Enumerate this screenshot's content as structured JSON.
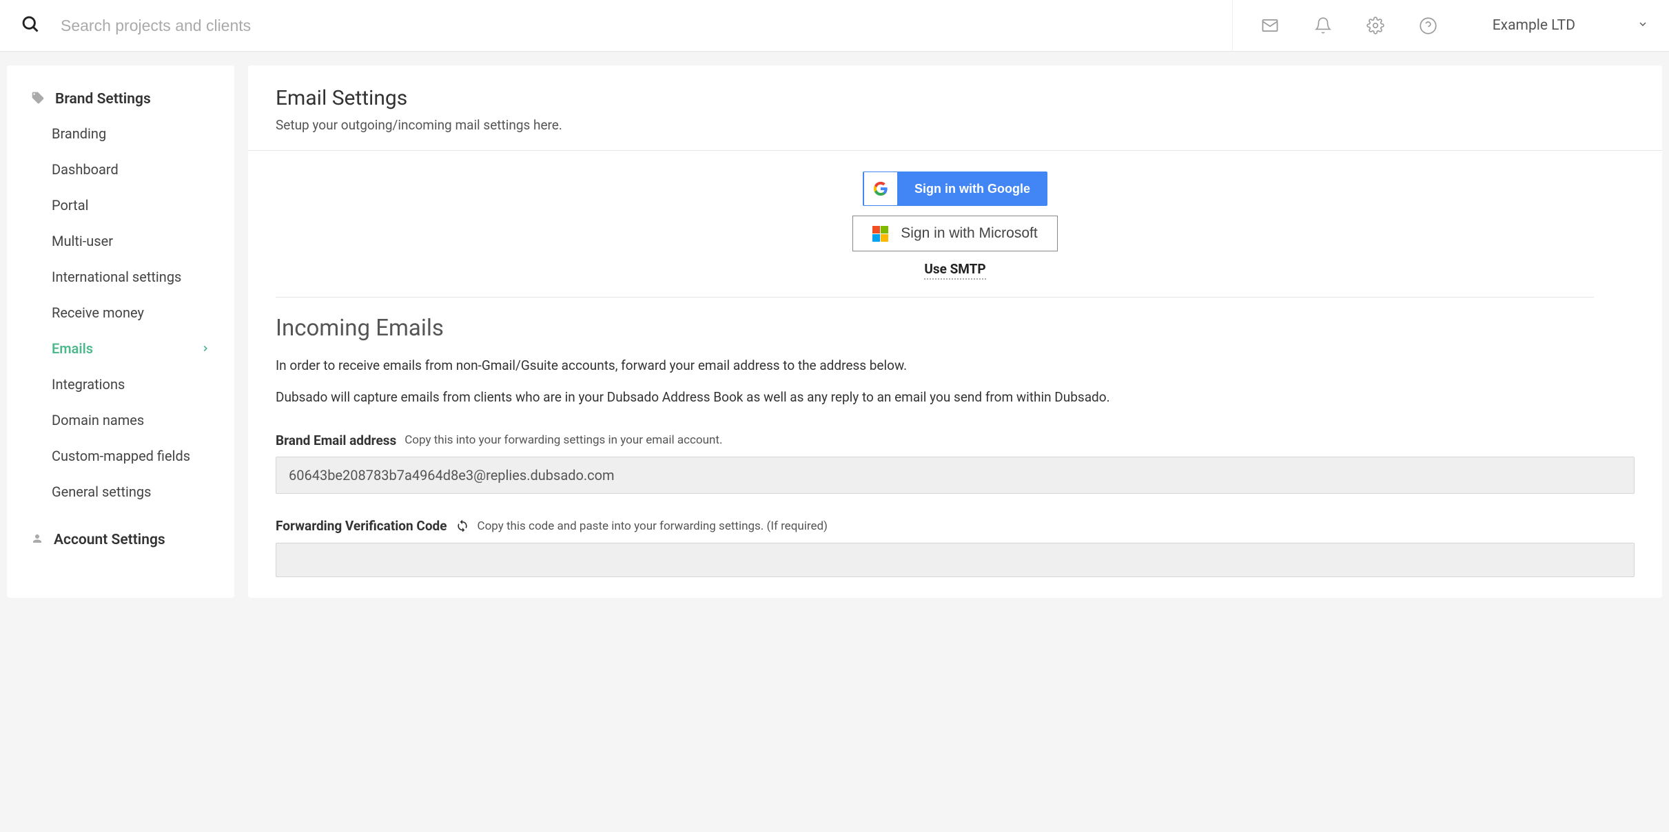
{
  "header": {
    "search_placeholder": "Search projects and clients",
    "brand_name": "Example LTD"
  },
  "sidebar": {
    "brand_settings_label": "Brand Settings",
    "items": [
      {
        "label": "Branding"
      },
      {
        "label": "Dashboard"
      },
      {
        "label": "Portal"
      },
      {
        "label": "Multi-user"
      },
      {
        "label": "International settings"
      },
      {
        "label": "Receive money"
      },
      {
        "label": "Emails"
      },
      {
        "label": "Integrations"
      },
      {
        "label": "Domain names"
      },
      {
        "label": "Custom-mapped fields"
      },
      {
        "label": "General settings"
      }
    ],
    "account_settings_label": "Account Settings"
  },
  "content": {
    "title": "Email Settings",
    "subtitle": "Setup your outgoing/incoming mail settings here.",
    "google_button": "Sign in with Google",
    "microsoft_button": "Sign in with Microsoft",
    "smtp_link": "Use SMTP",
    "incoming_title": "Incoming Emails",
    "incoming_text1": "In order to receive emails from non-Gmail/Gsuite accounts, forward your email address to the address below.",
    "incoming_text2": "Dubsado will capture emails from clients who are in your Dubsado Address Book as well as any reply to an email you send from within Dubsado.",
    "brand_email_label": "Brand Email address",
    "brand_email_hint": "Copy this into your forwarding settings in your email account.",
    "brand_email_value": "60643be208783b7a4964d8e3@replies.dubsado.com",
    "verification_label": "Forwarding Verification Code",
    "verification_hint": "Copy this code and paste into your forwarding settings. (If required)",
    "verification_value": ""
  }
}
